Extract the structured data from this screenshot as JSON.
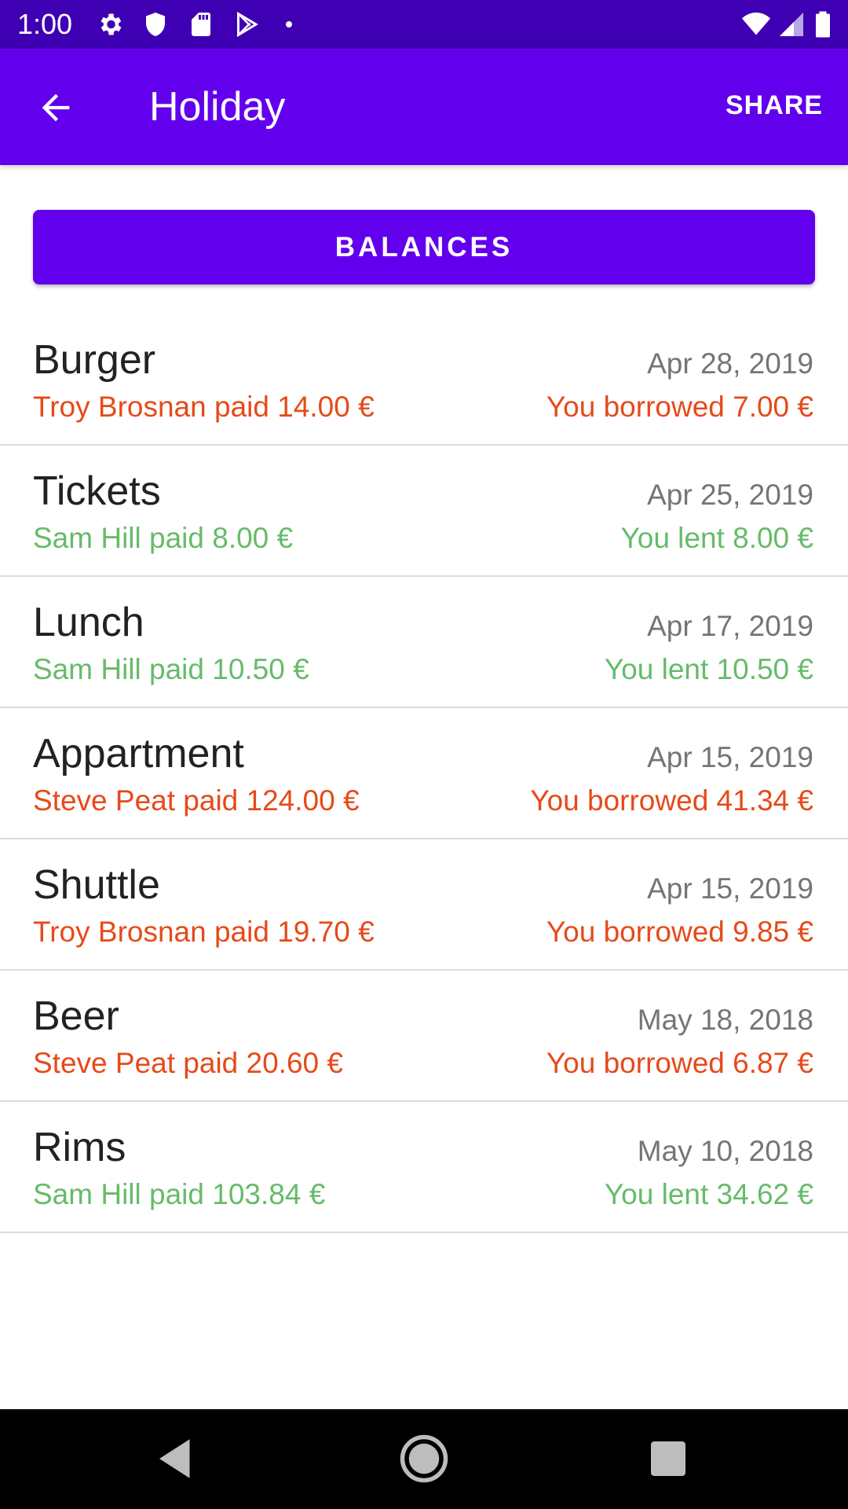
{
  "status_bar": {
    "time": "1:00",
    "icons_left": [
      "gear-icon",
      "shield-icon",
      "sd-card-icon",
      "play-store-icon",
      "dot-icon"
    ],
    "icons_right": [
      "wifi-icon",
      "cell-signal-icon",
      "battery-icon"
    ]
  },
  "app_bar": {
    "title": "Holiday",
    "share_label": "SHARE",
    "back_icon": "arrow-back-icon"
  },
  "balances_label": "BALANCES",
  "expenses": [
    {
      "title": "Burger",
      "date": "Apr 28, 2019",
      "payer": "Troy Brosnan paid 14.00 €",
      "share": "You borrowed 7.00 €",
      "type": "borrowed"
    },
    {
      "title": "Tickets",
      "date": "Apr 25, 2019",
      "payer": "Sam Hill paid 8.00 €",
      "share": "You lent 8.00 €",
      "type": "lent"
    },
    {
      "title": "Lunch",
      "date": "Apr 17, 2019",
      "payer": "Sam Hill paid 10.50 €",
      "share": "You lent 10.50 €",
      "type": "lent"
    },
    {
      "title": "Appartment",
      "date": "Apr 15, 2019",
      "payer": "Steve Peat paid 124.00 €",
      "share": "You borrowed 41.34 €",
      "type": "borrowed"
    },
    {
      "title": "Shuttle",
      "date": "Apr 15, 2019",
      "payer": "Troy Brosnan paid 19.70 €",
      "share": "You borrowed 9.85 €",
      "type": "borrowed"
    },
    {
      "title": "Beer",
      "date": "May 18, 2018",
      "payer": "Steve Peat paid 20.60 €",
      "share": "You borrowed 6.87 €",
      "type": "borrowed"
    },
    {
      "title": "Rims",
      "date": "May 10, 2018",
      "payer": "Sam Hill paid 103.84 €",
      "share": "You lent 34.62 €",
      "type": "lent"
    }
  ],
  "colors": {
    "primary": "#6200ee",
    "status_bar": "#3f00b3",
    "borrowed": "#e64a19",
    "lent": "#66bb6a",
    "title_text": "#222222",
    "date_text": "#757575",
    "divider": "#dcdcdc"
  },
  "nav_bar": {
    "icons": [
      "back-triangle-icon",
      "home-circle-icon",
      "recents-square-icon"
    ]
  }
}
